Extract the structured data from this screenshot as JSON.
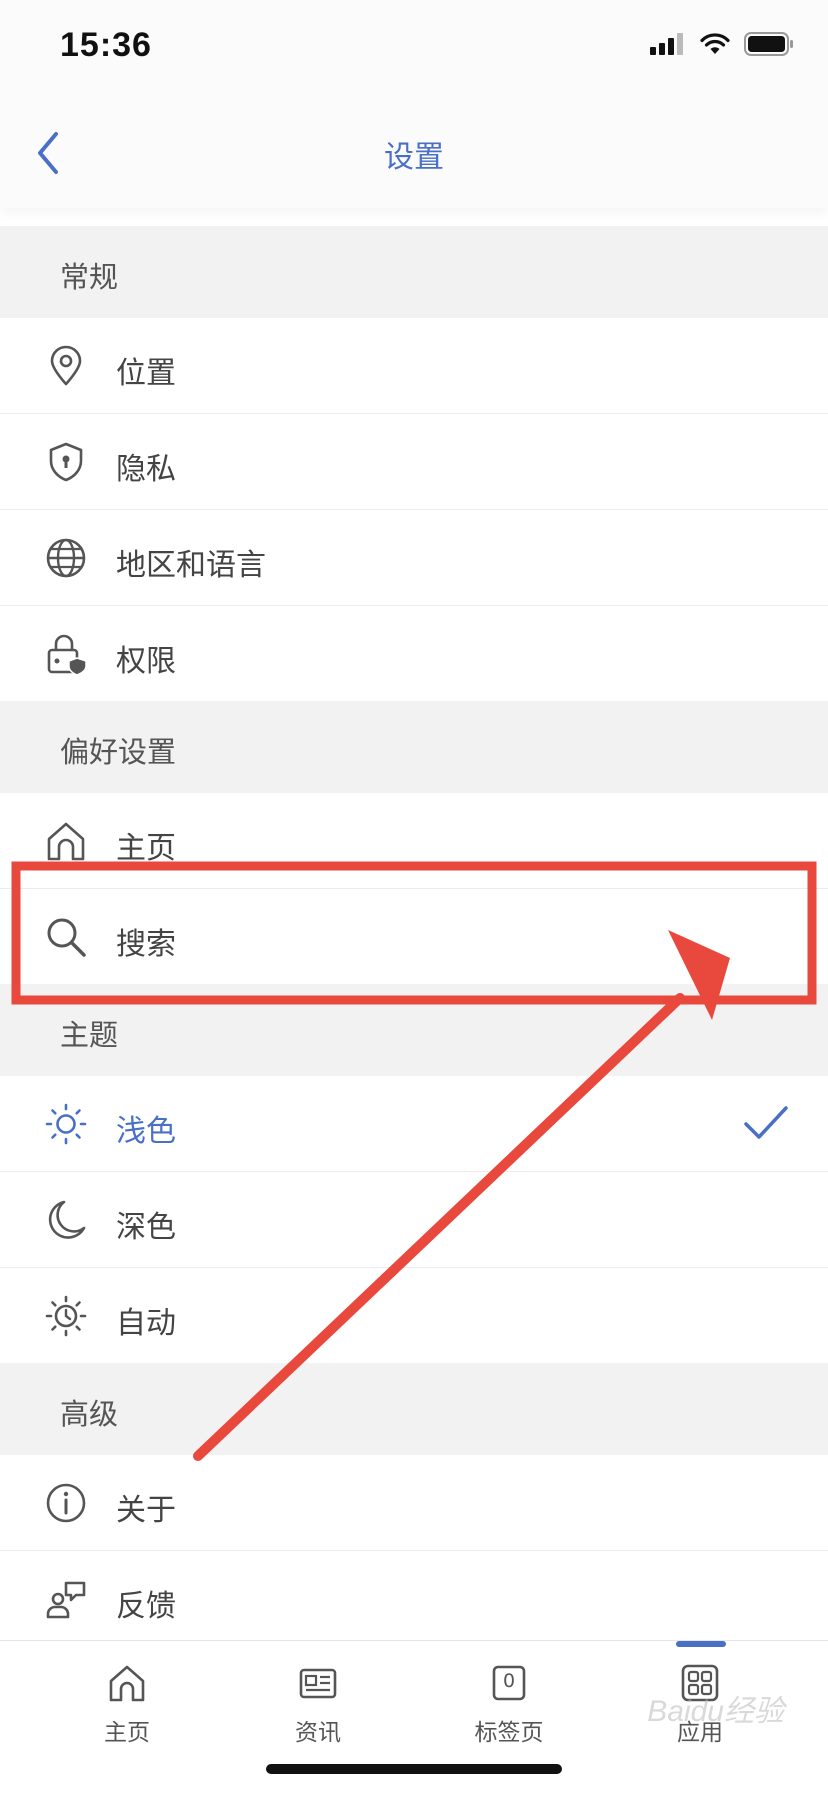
{
  "status_bar": {
    "time": "15:36"
  },
  "nav": {
    "title": "设置"
  },
  "sections": {
    "general": {
      "header": "常规",
      "items": [
        {
          "label": "位置",
          "icon": "location-pin-icon"
        },
        {
          "label": "隐私",
          "icon": "shield-lock-icon"
        },
        {
          "label": "地区和语言",
          "icon": "globe-icon"
        },
        {
          "label": "权限",
          "icon": "lock-shield-icon"
        }
      ]
    },
    "preferences": {
      "header": "偏好设置",
      "items": [
        {
          "label": "主页",
          "icon": "home-icon"
        },
        {
          "label": "搜索",
          "icon": "search-icon"
        }
      ]
    },
    "theme": {
      "header": "主题",
      "items": [
        {
          "label": "浅色",
          "icon": "sun-icon",
          "selected": true
        },
        {
          "label": "深色",
          "icon": "moon-icon"
        },
        {
          "label": "自动",
          "icon": "auto-theme-icon"
        }
      ]
    },
    "advanced": {
      "header": "高级",
      "items": [
        {
          "label": "关于",
          "icon": "info-icon"
        },
        {
          "label": "反馈",
          "icon": "feedback-icon"
        }
      ]
    }
  },
  "tabs": [
    {
      "label": "主页",
      "icon": "home-icon"
    },
    {
      "label": "资讯",
      "icon": "news-icon"
    },
    {
      "label": "标签页",
      "icon": "tabs-icon",
      "badge": "0"
    },
    {
      "label": "应用",
      "icon": "apps-grid-icon",
      "active": true
    }
  ],
  "watermark": "Baidu经验",
  "colors": {
    "accent": "#4a6fc7",
    "annotation": "#e9483c",
    "section_bg": "#f2f2f2"
  }
}
